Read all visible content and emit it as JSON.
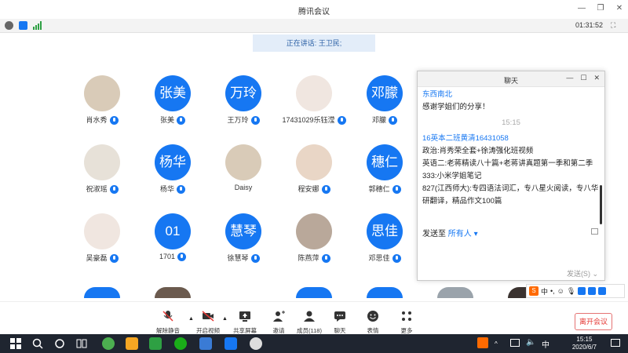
{
  "window": {
    "title": "腾讯会议"
  },
  "infobar": {
    "timer": "01:31:52"
  },
  "speaking": {
    "text": "正在讲话: 王卫民;"
  },
  "participants": [
    {
      "name": "肖水秀",
      "avatar_type": "photo"
    },
    {
      "name": "张美",
      "avatar_text": "张美",
      "avatar_type": "text"
    },
    {
      "name": "王万玲",
      "avatar_text": "万玲",
      "avatar_type": "text"
    },
    {
      "name": "17431029乐钰滢",
      "avatar_type": "photo"
    },
    {
      "name": "邓朦",
      "avatar_text": "邓朦",
      "avatar_type": "text"
    },
    {
      "name": "祝淑瑶",
      "avatar_type": "photo"
    },
    {
      "name": "杨华",
      "avatar_text": "杨华",
      "avatar_type": "text"
    },
    {
      "name": "Daisy",
      "avatar_type": "photo"
    },
    {
      "name": "程安娜",
      "avatar_type": "photo"
    },
    {
      "name": "郭穗仁",
      "avatar_text": "穗仁",
      "avatar_type": "text"
    },
    {
      "name": "吴豪磊",
      "avatar_type": "photo"
    },
    {
      "name": "1701",
      "avatar_text": "01",
      "avatar_type": "text"
    },
    {
      "name": "徐慧琴",
      "avatar_text": "慧琴",
      "avatar_type": "text"
    },
    {
      "name": "陈燕萍",
      "avatar_type": "photo"
    },
    {
      "name": "邓思佳",
      "avatar_text": "思佳",
      "avatar_type": "text"
    }
  ],
  "chat": {
    "title": "聊天",
    "messages": [
      {
        "sender": "东西南北",
        "text": "感谢学姐们的分享！"
      },
      {
        "time": "15:15"
      },
      {
        "sender": "16英本二班黄清16431058",
        "lines": [
          "政治:肖秀荣全套+徐涛强化班视频",
          "英语二:老蒋精读八十篇+老蒋讲真题第一季和第二季",
          "333:小米学姐笔记",
          "827(江西师大):专四语法词汇，专八星火阅读，专八华研翻译，精品作文100篇"
        ]
      }
    ],
    "send_to_label": "发送至",
    "send_to_target": "所有人",
    "send_button": "发送(S)"
  },
  "toolbar": {
    "items": [
      "解除静音",
      "开启视频",
      "共享屏幕",
      "邀请",
      "成员(118)",
      "聊天",
      "表情",
      "更多"
    ],
    "leave": "离开会议"
  },
  "ime": {
    "lang": "中"
  },
  "taskbar": {
    "time": "15:15",
    "date": "2020/6/7"
  },
  "colors": {
    "accent": "#1677f2",
    "danger": "#e53935"
  }
}
